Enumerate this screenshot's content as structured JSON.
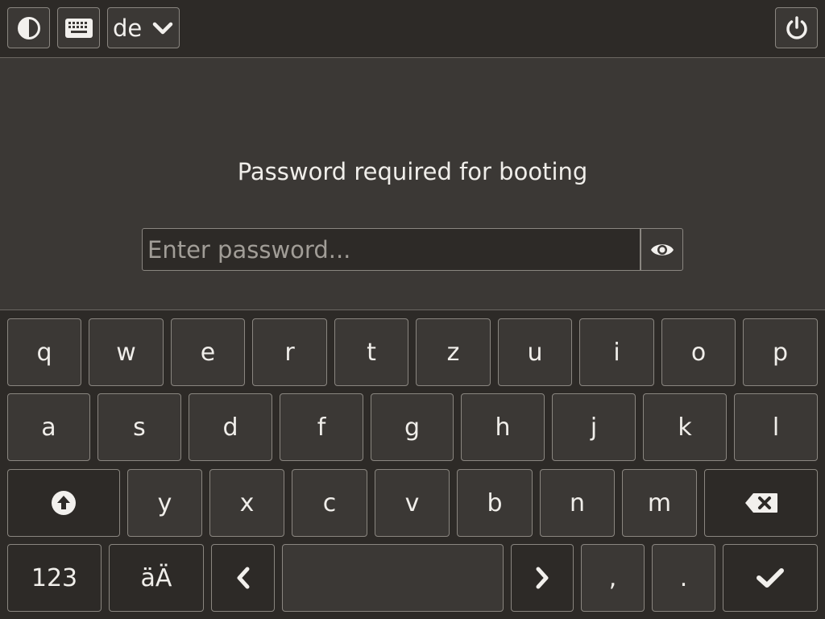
{
  "topbar": {
    "contrast_icon": "contrast-icon",
    "keyboard_icon": "keyboard-icon",
    "layout_label": "de",
    "layout_chevron_icon": "chevron-down-icon",
    "power_icon": "power-icon"
  },
  "main": {
    "prompt": "Password required for booting",
    "password_value": "",
    "password_placeholder": "Enter password...",
    "reveal_icon": "eye-icon"
  },
  "keyboard": {
    "row1": [
      "q",
      "w",
      "e",
      "r",
      "t",
      "z",
      "u",
      "i",
      "o",
      "p"
    ],
    "row2": [
      "a",
      "s",
      "d",
      "f",
      "g",
      "h",
      "j",
      "k",
      "l"
    ],
    "row3": [
      "y",
      "x",
      "c",
      "v",
      "b",
      "n",
      "m"
    ],
    "shift_icon": "shift-up-arrow-icon",
    "backspace_icon": "backspace-icon",
    "numbers_label": "123",
    "umlaut_label": "äÄ",
    "left_icon": "chevron-left-icon",
    "right_icon": "chevron-right-icon",
    "comma_label": ",",
    "period_label": ".",
    "enter_icon": "checkmark-icon"
  },
  "colors": {
    "background": "#3b3835",
    "bar_background": "#2d2a27",
    "border": "#8a8680",
    "text": "#f0eeea"
  }
}
